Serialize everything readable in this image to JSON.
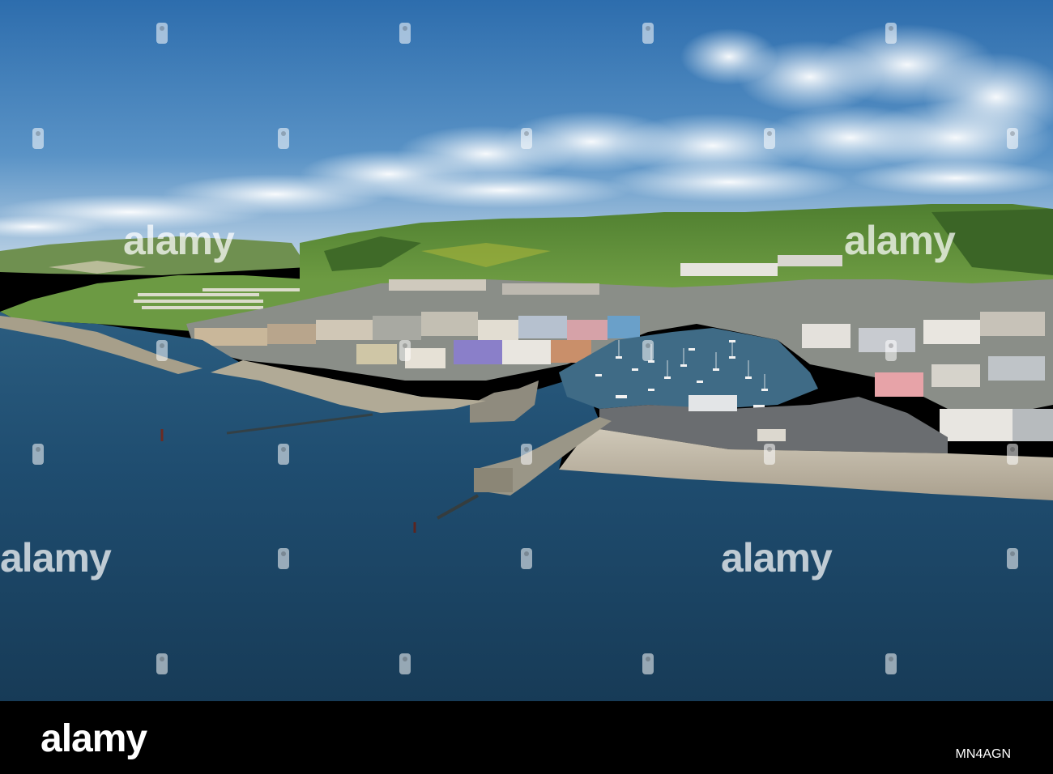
{
  "watermark": {
    "brand": "alamy",
    "image_code": "MN4AGN"
  },
  "colors": {
    "sky_top": "#2f6fae",
    "sky_horizon": "#c4d8ea",
    "sea": "#1f4f72",
    "hills": "#5a8a3a",
    "bar": "#000000"
  }
}
